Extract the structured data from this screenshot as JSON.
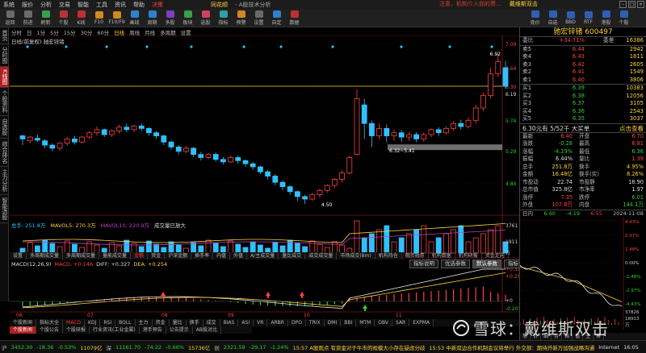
{
  "menu": {
    "items": [
      "系统",
      "报价",
      "分析",
      "交易",
      "智能",
      "工具",
      "资讯",
      "帮助",
      "决策"
    ],
    "brand": "同花顺",
    "app": "- A股技术分析",
    "notice": "注意，机构介入你的票...",
    "notice2": "戴维斯双击"
  },
  "toolbar": {
    "buttons": [
      "返回",
      "前进",
      "刷新",
      "个股",
      "K线",
      "F10",
      "F10/F9",
      "画线",
      "周期",
      "多股",
      "板块",
      "选股",
      "指标",
      "预警",
      "设置",
      "自定",
      "数据"
    ],
    "right_buttons": [
      "竞价",
      "自选",
      "BBD",
      "RTF",
      "港股",
      "个股"
    ]
  },
  "sidebar": [
    "首页",
    "分时图",
    "K线图",
    "个股资料",
    "自选股",
    "综合排名",
    "主力分析",
    "智能选股"
  ],
  "period": {
    "items": [
      "分时",
      "日",
      "1分",
      "5分",
      "15分",
      "30分",
      "60分",
      "日线",
      "周线",
      "月线",
      "多周期",
      "设置"
    ],
    "selected": "日线"
  },
  "chart": {
    "title": "日线(前复权) 驰宏锌锗",
    "price_axis": [
      "7.09",
      "6.64",
      "6.30",
      "6.19",
      "5.74",
      "5.29",
      "4.84"
    ],
    "high_label": "6.92",
    "low_label": "4.50",
    "range_label": "6.32~5.41",
    "date_ticks": [
      "06",
      "07",
      "08",
      "09",
      "10",
      "11"
    ]
  },
  "volume": {
    "label_total": "总手: 251.8万",
    "mavol5": "MAVOL5: 270.3万",
    "mavol10": "MAVOL10: 220.9万",
    "extra": "成交量已放大",
    "axis": [
      "3761",
      "1911",
      "万"
    ]
  },
  "tabs_indicator": [
    "设置",
    "多周期成交量",
    "多周期成交量",
    "量能成交量",
    "金额",
    "资金",
    "沪深金额",
    "换手率",
    "内盘",
    "外盘",
    "A/主成交量",
    "量比成交",
    "成交成交量",
    "市场成交(8m)",
    "机构持仓",
    "融资融券",
    "机构数据",
    "机构研报",
    "资金走向"
  ],
  "macd": {
    "name": "MACD(12,26,9)",
    "macd_val": "MACD: +0.146",
    "dif": "DIFF: +0.327",
    "dea": "DEA: +0.254",
    "axis": [
      "+0.330",
      "+0.251",
      "+0",
      "-0.203"
    ],
    "buttons": [
      "指标说明",
      "优选参数",
      "默认参数",
      "指标说明"
    ],
    "selected_button": "默认参数"
  },
  "tabs_bottom": [
    "个股新闻",
    "指标大全",
    "MACD",
    "KDJ",
    "RSI",
    "BOLL",
    "主力",
    "资金",
    "量比",
    "换手",
    "成交",
    "BIAS",
    "ASI",
    "VR",
    "ARBR",
    "DPO",
    "TRIX",
    "DMI",
    "BBI",
    "MTM",
    "OBV",
    "SAR",
    "EXPMA"
  ],
  "tabs_news": [
    "个股新闻",
    "个股公告",
    "个股研报",
    "行业资讯(工业金属)",
    "港手预告",
    "公告提示",
    "AB股对比"
  ],
  "status": {
    "sh_label": "沪",
    "sh_value": "3452.30",
    "sh_change": "-18.36",
    "sh_pct": "-0.53%",
    "sh_amount": "11079亿",
    "sz_label": "深",
    "sz_value": "11161.70",
    "sz_change": "-74.22",
    "sz_pct": "-0.66%",
    "sz_amount": "15736亿",
    "cy_label": "创",
    "cy_value": "2321.59",
    "cy_change": "-29.17",
    "cy_pct": "-1.24%",
    "ticker": "15:57 A股观点 有资金对于牛市的规模大小存在疑虑分歧",
    "ticker2": "15:53 中新双边合作机制会议将举行 外交部：期待开新万加强战略沟通",
    "time": "16:05",
    "mode": "Internet"
  },
  "right_panel": {
    "stock_name": "驰宏锌锗",
    "stock_code": "600497",
    "weibi_label": "委比",
    "weibi_value": "+34.71%",
    "weicha_label": "委差",
    "weicha_value": "16386",
    "sells": [
      {
        "label": "卖5",
        "price": "6.44",
        "vol": "2942"
      },
      {
        "label": "卖4",
        "price": "6.43",
        "vol": "1811"
      },
      {
        "label": "卖3",
        "price": "6.42",
        "vol": "2605"
      },
      {
        "label": "卖2",
        "price": "6.41",
        "vol": "1549"
      },
      {
        "label": "卖1",
        "price": "6.40",
        "vol": "3806"
      }
    ],
    "buys": [
      {
        "label": "买1",
        "price": "6.39",
        "vol": "10383"
      },
      {
        "label": "买2",
        "price": "6.38",
        "vol": "12056"
      },
      {
        "label": "买3",
        "price": "6.37",
        "vol": "3105"
      },
      {
        "label": "买4",
        "price": "6.36",
        "vol": "2543"
      },
      {
        "label": "买5",
        "price": "6.35",
        "vol": "3037"
      }
    ],
    "headline": "6.30元有 5/52千 大买单",
    "headline_link": "点击查看",
    "stats": [
      {
        "k": "最新",
        "v": "6.40",
        "k2": "开盘",
        "v2": "6.70",
        "vc": "up",
        "v2c": "up"
      },
      {
        "k": "涨跌",
        "v": "-0.28",
        "k2": "最高",
        "v2": "6.81",
        "vc": "dn",
        "v2c": "up"
      },
      {
        "k": "涨幅",
        "v": "-4.19%",
        "k2": "最低",
        "v2": "6.36",
        "vc": "dn",
        "v2c": "dn"
      },
      {
        "k": "振幅",
        "v": "6.44%",
        "k2": "量比",
        "v2": "1.39",
        "vc": "wh",
        "v2c": "up"
      },
      {
        "k": "总手",
        "v": "251.8万",
        "k2": "换手",
        "v2": "4.95%",
        "vc": "yl",
        "v2c": "yl"
      },
      {
        "k": "金额",
        "v": "16.48亿",
        "k2": "换手(实)",
        "v2": "8.26%",
        "vc": "yl",
        "v2c": "yl"
      },
      {
        "k": "市盈动",
        "v": "22.74",
        "k2": "市盈静",
        "v2": "18.90",
        "vc": "wh",
        "v2c": "wh"
      },
      {
        "k": "总市值",
        "v": "325.8亿",
        "k2": "市净率",
        "v2": "1.97",
        "vc": "wh",
        "v2c": "wh"
      },
      {
        "k": "涨停",
        "v": "7.35",
        "k2": "跌停",
        "v2": "6.01",
        "vc": "up",
        "v2c": "dn"
      },
      {
        "k": "外盘",
        "v": "107.8万",
        "k2": "内盘",
        "v2": "144.1万",
        "vc": "up",
        "v2c": "dn"
      }
    ],
    "mini_info": {
      "a": "日内",
      "b": "6.40",
      "c": "-4.19",
      "d": "6.55",
      "date": "2024-11-08"
    },
    "mini_axis": [
      "4.43%",
      "2.97%",
      "1.48%",
      "0.00%",
      "-1.48%",
      "-2.97%",
      "-4.43%",
      "37826",
      "18913",
      "万"
    ],
    "mini_tabs": [
      "笔",
      "价",
      "细",
      "势",
      "指",
      "值",
      "主",
      "筹"
    ]
  },
  "watermark": "雪球：戴维斯双击",
  "colors": {
    "up": "#ff4040",
    "down": "#2fd02f",
    "cyan": "#30c0ff",
    "yellow": "#ffd23c",
    "purple": "#c040c0"
  }
}
